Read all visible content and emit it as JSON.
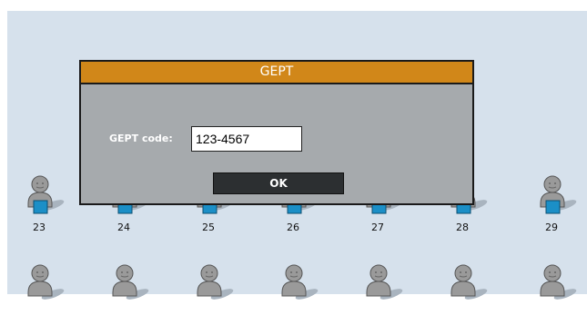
{
  "dialog": {
    "title": "GEPT",
    "field_label": "GEPT code:",
    "field_value": "123-4567",
    "ok_label": "OK"
  },
  "seats_row1": [
    "23",
    "24",
    "25",
    "26",
    "27",
    "28",
    "29"
  ],
  "colors": {
    "background": "#d6e1ec",
    "title_bar": "#d18719",
    "dialog_body": "#a6aaad",
    "button": "#2c2f31",
    "desk": "#1b8fc7"
  }
}
